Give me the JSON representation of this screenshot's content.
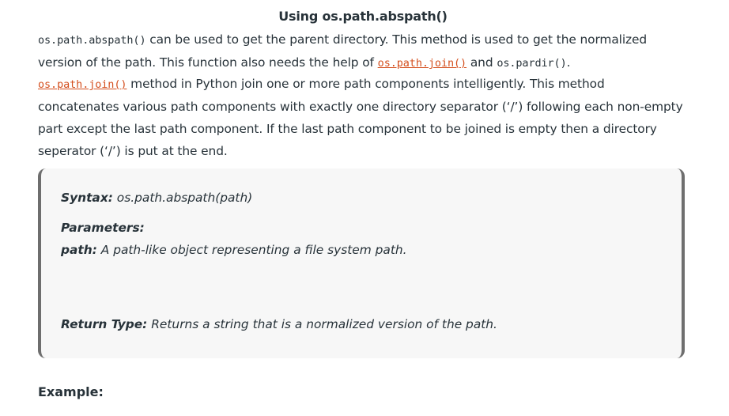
{
  "heading": "Using os.path.abspath()",
  "para1": {
    "code1": "os.path.abspath()",
    "text1": " can be used to get the parent directory. This method is used to get the normalized version of the path. This function also needs the help of ",
    "link1": "os.path.join()",
    "text2": " and ",
    "code2": "os.pardir()",
    "text3": "."
  },
  "para2": {
    "link": "os.path.join()",
    "text": " method in Python join one or more path components intelligently. This method concatenates various path components with exactly one directory separator (‘/’) following each non-empty part except the last path component. If the last path component to be joined is empty then a directory seperator (‘/’) is put at the end."
  },
  "box": {
    "syntax_label": "Syntax:",
    "syntax_value": " os.path.abspath(path)",
    "parameters_label": "Parameters:",
    "path_label": "path:",
    "path_desc": " A path-like object representing a file system path.",
    "return_label": "Return Type:",
    "return_desc": " Returns a string that is a normalized version of the path."
  },
  "example_label": "Example:"
}
